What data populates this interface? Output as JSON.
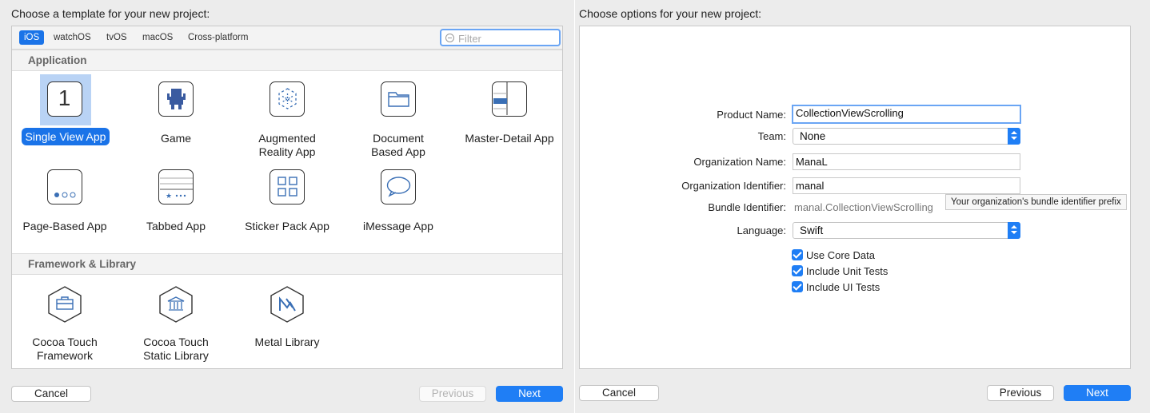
{
  "left": {
    "prompt": "Choose a template for your new project:",
    "tabs": [
      {
        "label": "iOS",
        "selected": true
      },
      {
        "label": "watchOS",
        "selected": false
      },
      {
        "label": "tvOS",
        "selected": false
      },
      {
        "label": "macOS",
        "selected": false
      },
      {
        "label": "Cross-platform",
        "selected": false
      }
    ],
    "filter_placeholder": "Filter",
    "sections": [
      {
        "title": "Application",
        "templates": [
          {
            "label": "Single View App",
            "icon": "single-view-icon",
            "selected": true
          },
          {
            "label": "Game",
            "icon": "game-icon"
          },
          {
            "label": "Augmented\nReality App",
            "icon": "ar-icon"
          },
          {
            "label": "Document\nBased App",
            "icon": "folder-icon"
          },
          {
            "label": "Master-Detail App",
            "icon": "master-detail-icon"
          },
          {
            "label": "Page-Based App",
            "icon": "page-dots-icon"
          },
          {
            "label": "Tabbed App",
            "icon": "tab-bar-icon"
          },
          {
            "label": "Sticker Pack App",
            "icon": "grid-icon"
          },
          {
            "label": "iMessage App",
            "icon": "speech-bubble-icon"
          }
        ]
      },
      {
        "title": "Framework & Library",
        "templates": [
          {
            "label": "Cocoa Touch\nFramework",
            "icon": "toolbox-icon"
          },
          {
            "label": "Cocoa Touch\nStatic Library",
            "icon": "building-icon"
          },
          {
            "label": "Metal Library",
            "icon": "metal-icon"
          }
        ]
      }
    ],
    "icon_text": {
      "single_view_number": "1"
    },
    "buttons": {
      "cancel": "Cancel",
      "previous": "Previous",
      "next": "Next"
    }
  },
  "right": {
    "prompt": "Choose options for your new project:",
    "form": {
      "product_name_label": "Product Name:",
      "product_name_value": "CollectionViewScrolling",
      "team_label": "Team:",
      "team_value": "None",
      "org_name_label": "Organization Name:",
      "org_name_value": "ManaL",
      "org_id_label": "Organization Identifier:",
      "org_id_value": "manal",
      "bundle_id_label": "Bundle Identifier:",
      "bundle_id_value": "manal.CollectionViewScrolling",
      "language_label": "Language:",
      "language_value": "Swift",
      "checkboxes": [
        {
          "label": "Use Core Data",
          "checked": true
        },
        {
          "label": "Include Unit Tests",
          "checked": true
        },
        {
          "label": "Include UI Tests",
          "checked": true
        }
      ]
    },
    "tooltip": "Your organization's bundle identifier prefix",
    "buttons": {
      "cancel": "Cancel",
      "previous": "Previous",
      "next": "Next"
    }
  },
  "colors": {
    "accent": "#1f7ef5",
    "selection": "#1a73e8"
  }
}
